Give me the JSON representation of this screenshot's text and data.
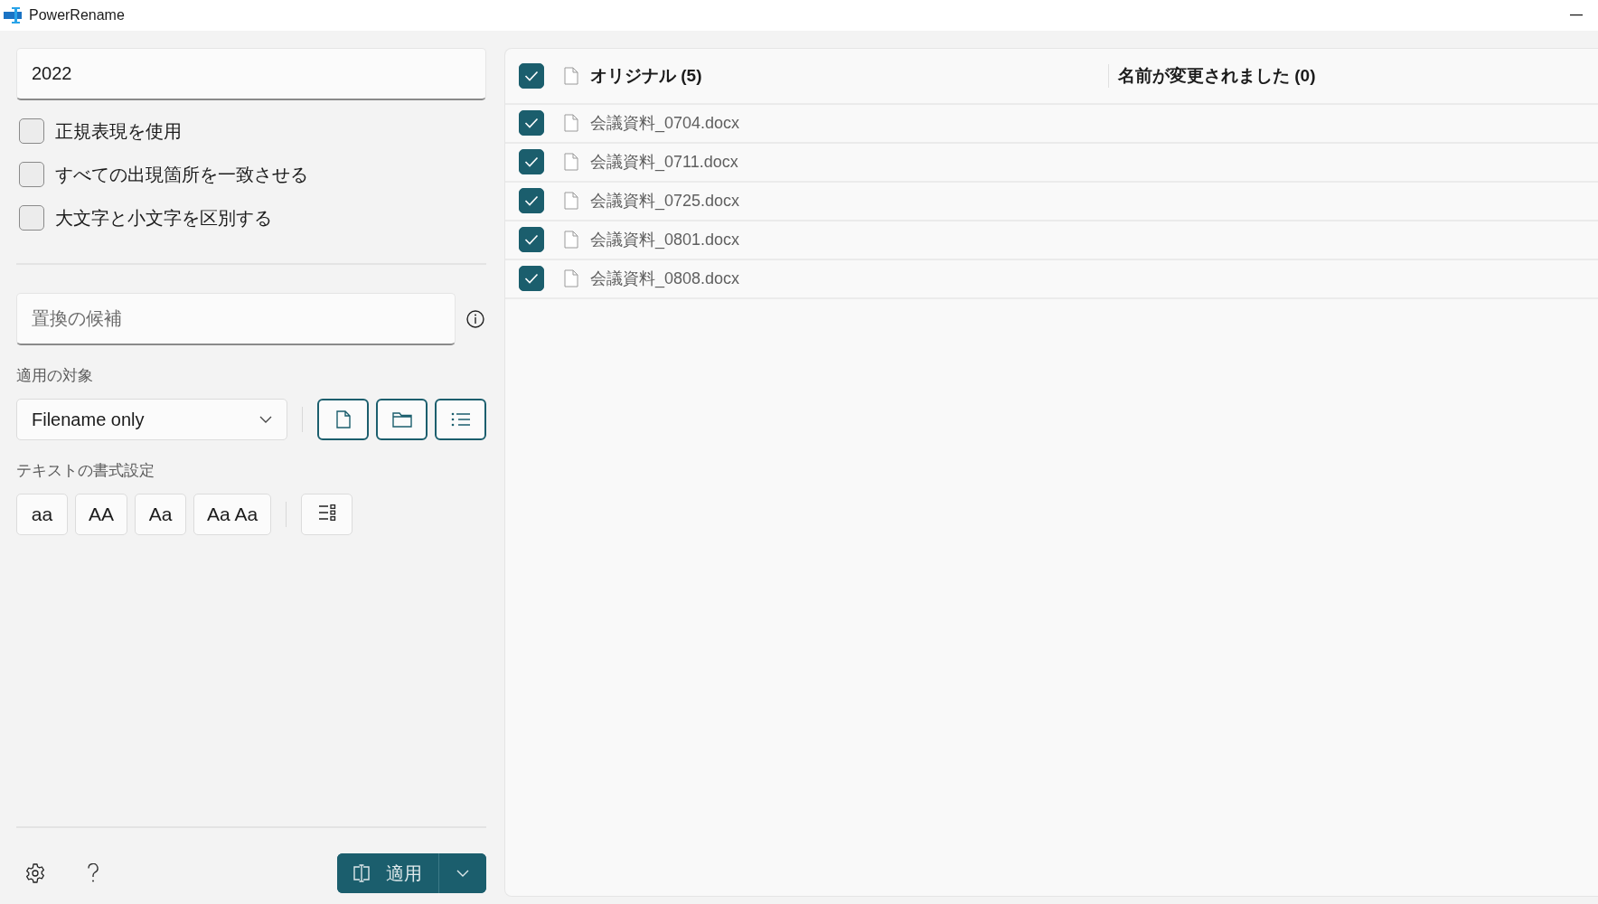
{
  "window": {
    "title": "PowerRename"
  },
  "search": {
    "value": "2022"
  },
  "options": [
    {
      "label": "正規表現を使用",
      "checked": false
    },
    {
      "label": "すべての出現箇所を一致させる",
      "checked": false
    },
    {
      "label": "大文字と小文字を区別する",
      "checked": false
    }
  ],
  "replace": {
    "placeholder": "置換の候補"
  },
  "apply_to": {
    "label": "適用の対象",
    "value": "Filename only"
  },
  "scope_toggles": [
    {
      "kind": "file"
    },
    {
      "kind": "folder"
    },
    {
      "kind": "list"
    }
  ],
  "text_format": {
    "label": "テキストの書式設定",
    "buttons": [
      {
        "label": "aa",
        "selected": false
      },
      {
        "label": "AA",
        "selected": false
      },
      {
        "label": "Aa",
        "selected": false
      },
      {
        "label": "Aa Aa",
        "selected": false
      }
    ]
  },
  "apply_button": {
    "label": "適用"
  },
  "file_list": {
    "select_all_checked": true,
    "columns": [
      "オリジナル (5)",
      "名前が変更されました (0)"
    ],
    "rows": [
      {
        "name": "会議資料_0704.docx",
        "checked": true
      },
      {
        "name": "会議資料_0711.docx",
        "checked": true
      },
      {
        "name": "会議資料_0725.docx",
        "checked": true
      },
      {
        "name": "会議資料_0801.docx",
        "checked": true
      },
      {
        "name": "会議資料_0808.docx",
        "checked": true
      }
    ]
  }
}
